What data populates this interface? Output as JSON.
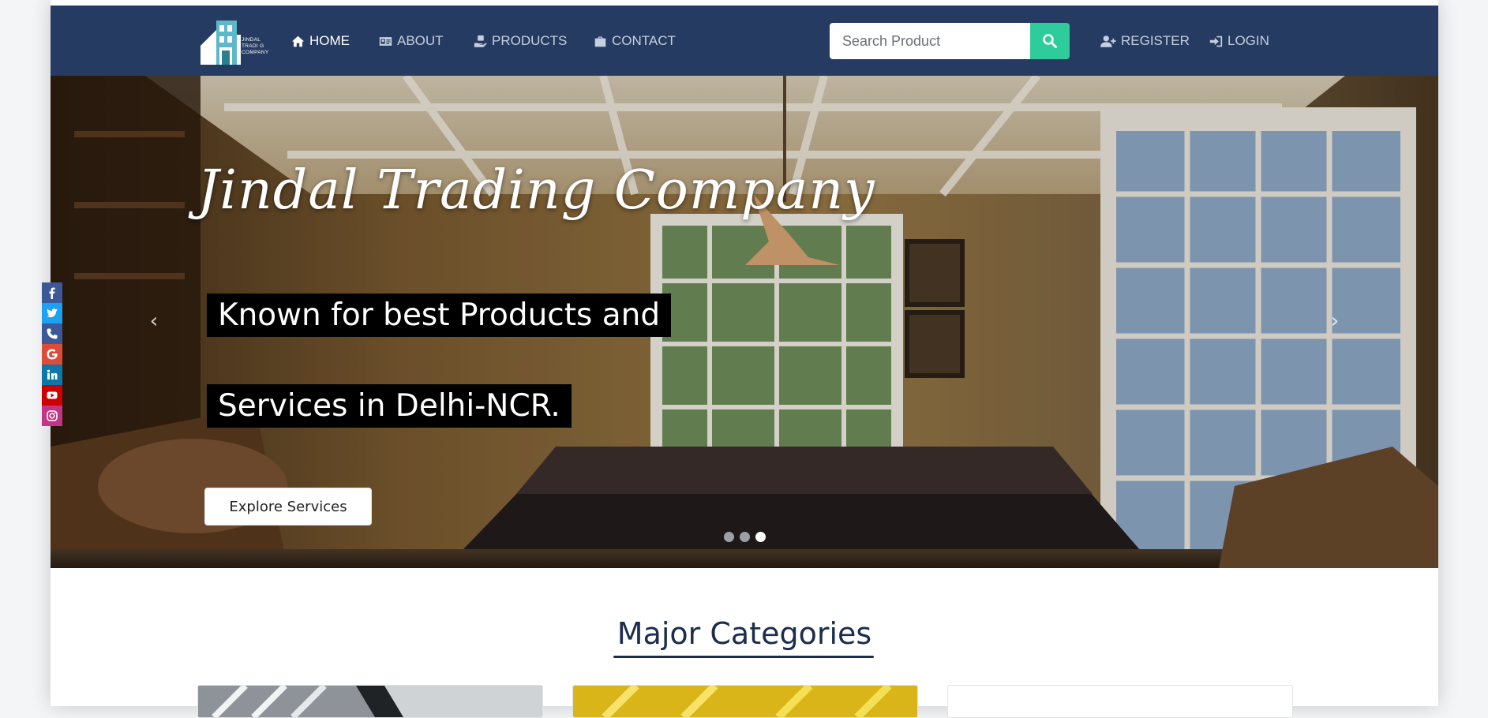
{
  "brand": {
    "logo_lines": [
      "JINDAL",
      "TRADI G",
      "COMPANY"
    ],
    "logo_color": "#5fb8c7"
  },
  "nav": {
    "items": [
      {
        "label": "HOME",
        "icon": "home-icon",
        "active": true
      },
      {
        "label": "ABOUT",
        "icon": "id-card-icon",
        "active": false
      },
      {
        "label": "PRODUCTS",
        "icon": "hand-product-icon",
        "active": false
      },
      {
        "label": "CONTACT",
        "icon": "briefcase-icon",
        "active": false
      }
    ],
    "search_placeholder": "Search Product",
    "search_icon": "search-icon",
    "register_label": "REGISTER",
    "register_icon": "user-plus-icon",
    "login_label": "LOGIN",
    "login_icon": "sign-in-icon",
    "bg_color": "#253b61",
    "accent_color": "#2ecc9a"
  },
  "hero": {
    "title": "Jindal Trading Company",
    "tagline_line1": "Known for best Products and",
    "tagline_line2": "Services in Delhi-NCR.",
    "button_label": "Explore Services",
    "prev_icon": "chevron-left-icon",
    "next_icon": "chevron-right-icon",
    "slides": 3,
    "active_slide": 3
  },
  "social": {
    "items": [
      {
        "name": "facebook-icon",
        "color": "#3b5998"
      },
      {
        "name": "twitter-icon",
        "color": "#1da1f2"
      },
      {
        "name": "phone-icon",
        "color": "#3b5998"
      },
      {
        "name": "google-icon",
        "color": "#dd4b39"
      },
      {
        "name": "linkedin-icon",
        "color": "#0e76a8"
      },
      {
        "name": "youtube-icon",
        "color": "#cc0000"
      },
      {
        "name": "instagram-icon",
        "color": "#c13584"
      }
    ]
  },
  "section": {
    "title": "Major Categories"
  }
}
